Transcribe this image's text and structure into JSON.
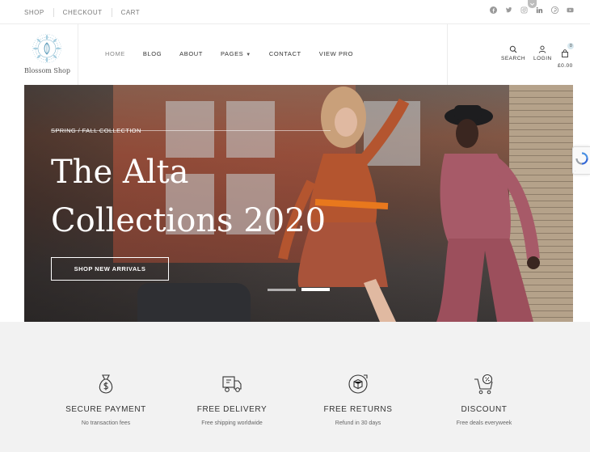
{
  "topbar": {
    "links": [
      "SHOP",
      "CHECKOUT",
      "CART"
    ],
    "social": [
      "facebook-icon",
      "twitter-icon",
      "instagram-icon",
      "linkedin-icon",
      "pinterest-icon",
      "youtube-icon"
    ]
  },
  "header": {
    "logo_name": "Blossom Shop",
    "nav": [
      {
        "label": "HOME",
        "active": true
      },
      {
        "label": "BLOG"
      },
      {
        "label": "ABOUT"
      },
      {
        "label": "PAGES",
        "has_dropdown": true
      },
      {
        "label": "CONTACT"
      },
      {
        "label": "VIEW PRO"
      }
    ],
    "search_label": "SEARCH",
    "login_label": "LOGIN",
    "cart_total": "£0.00",
    "cart_count": "0"
  },
  "hero": {
    "eyebrow": "SPRING / FALL COLLECTION",
    "title_line1": "The Alta",
    "title_line2": "Collections 2020",
    "cta_label": "SHOP NEW ARRIVALS",
    "slides": 2,
    "active_slide": 2
  },
  "features": [
    {
      "icon": "money-bag-icon",
      "title": "SECURE PAYMENT",
      "subtitle": "No transaction fees"
    },
    {
      "icon": "delivery-truck-icon",
      "title": "FREE DELIVERY",
      "subtitle": "Free shipping worldwide"
    },
    {
      "icon": "returns-box-icon",
      "title": "FREE RETURNS",
      "subtitle": "Refund in 30 days"
    },
    {
      "icon": "discount-cart-icon",
      "title": "DISCOUNT",
      "subtitle": "Free deals everyweek"
    }
  ],
  "colors": {
    "topbar_text": "#7a7a7a",
    "feature_bg": "#f2f2f2",
    "logo_accent": "#5a9fc0"
  }
}
